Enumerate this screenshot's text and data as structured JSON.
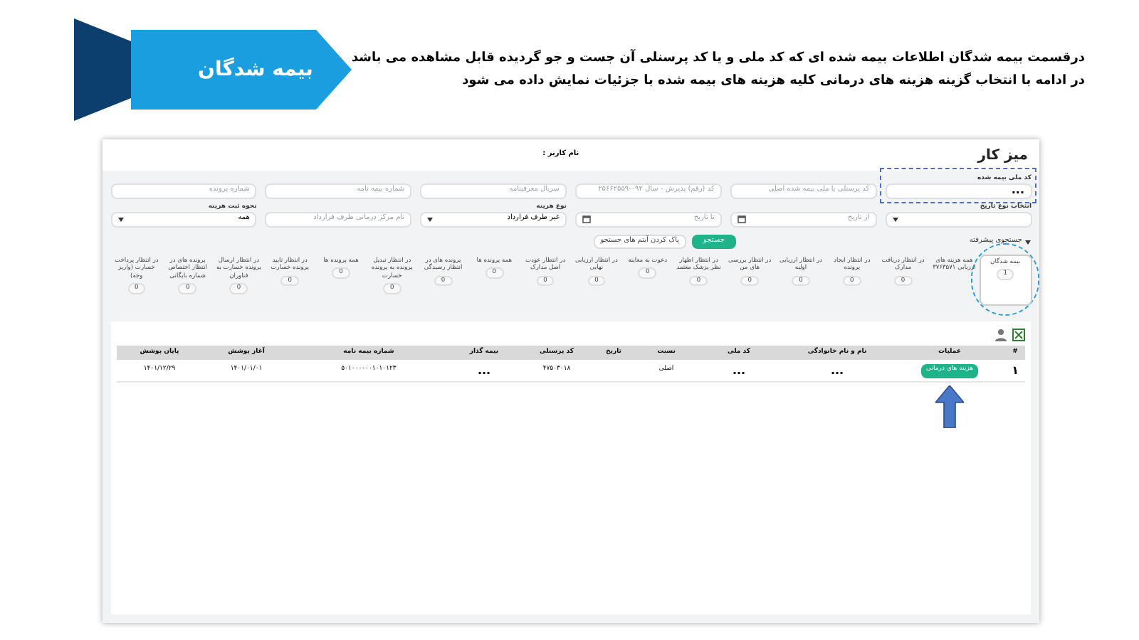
{
  "banner": {
    "title": "بیمه شدگان"
  },
  "description": [
    "درقسمت بیمه شدگان اطلاعات بیمه شده ای که کد ملی و یا کد پرسنلی آن جست و جو گردیده قابل مشاهده می باشد",
    "در ادامه با انتخاب گزینه هزینه های درمانی کلیه هزینه های بیمه شده با جزئیات نمایش داده می شود"
  ],
  "screen": {
    "title": "میز کار",
    "user_label": "نام کاربر :",
    "filters": [
      {
        "kind": "dots",
        "label": "کد ملی بیمه شده",
        "value": "...",
        "highlighted": true
      },
      {
        "kind": "text",
        "placeholder": "کد پرسنلی یا ملی بیمه شده اصلی",
        "highlighted": false
      },
      {
        "kind": "text",
        "placeholder": "کد (رقم) پذیرش - سال  ۰۹۲-۲۵۶۶۲۵۵۹",
        "highlighted": false
      },
      {
        "kind": "text",
        "placeholder": "سریال معرفینامه",
        "highlighted": false
      },
      {
        "kind": "text",
        "placeholder": "شماره بیمه نامه",
        "highlighted": false
      },
      {
        "kind": "text",
        "placeholder": "شماره پرونده",
        "highlighted": false
      },
      {
        "kind": "select",
        "label": "انتخاب نوع تاریخ",
        "highlighted": false
      },
      {
        "kind": "date",
        "placeholder": "از تاریخ",
        "highlighted": false
      },
      {
        "kind": "date",
        "placeholder": "تا تاریخ",
        "highlighted": false
      },
      {
        "kind": "select",
        "label": "نوع هزینه",
        "value": "غیر طرف قرارداد",
        "highlighted": false
      },
      {
        "kind": "text",
        "placeholder": "نام مرکز درمانی طرف قرارداد",
        "highlighted": false
      },
      {
        "kind": "select",
        "label": "نحوه ثبت هزینه",
        "value": "همه",
        "highlighted": false
      }
    ],
    "advanced_search": "جستجوی پیشرفته",
    "buttons": [
      {
        "label": "جستجو",
        "kind": "primary"
      },
      {
        "label": "پاک کردن آیتم های جستجو",
        "kind": "secondary"
      }
    ],
    "status_tabs": [
      {
        "label": "بیمه شدگان",
        "count": "1",
        "selected": true,
        "highlighted": true
      },
      {
        "label": "همه هزینه های ارزیابی ۳۷۶۳۵۷۱",
        "selected": false,
        "highlighted": false
      },
      {
        "label": "در انتظار دریافت مدارک",
        "count": "0",
        "selected": false,
        "highlighted": false
      },
      {
        "label": "در انتظار ایجاد پرونده",
        "count": "0",
        "selected": false,
        "highlighted": false
      },
      {
        "label": "در انتظار ارزیابی اولیه",
        "count": "0",
        "selected": false,
        "highlighted": false
      },
      {
        "label": "در انتظار بررسی های من",
        "count": "0",
        "selected": false,
        "highlighted": false
      },
      {
        "label": "در انتظار اظهار نظر پزشک معتمد",
        "count": "0",
        "selected": false,
        "highlighted": false
      },
      {
        "label": "دعوت به معاینه",
        "count": "0",
        "selected": false,
        "highlighted": false
      },
      {
        "label": "در انتظار ارزیابی نهایی",
        "count": "0",
        "selected": false,
        "highlighted": false
      },
      {
        "label": "در انتظار عودت اصل مدارک",
        "count": "0",
        "selected": false,
        "highlighted": false
      },
      {
        "label": "همه پرونده ها",
        "count": "0",
        "selected": false,
        "highlighted": false
      },
      {
        "label": "پرونده های در انتظار رسیدگی",
        "count": "0",
        "selected": false,
        "highlighted": false
      },
      {
        "label": "در انتظار تبدیل پرونده به پرونده خسارت",
        "count": "0",
        "selected": false,
        "highlighted": false
      },
      {
        "label": "همه پرونده ها",
        "count": "0",
        "selected": false,
        "highlighted": false
      },
      {
        "label": "در انتظار تایید پرونده خسارت",
        "count": "0",
        "selected": false,
        "highlighted": false
      },
      {
        "label": "در انتظار ارسال پرونده خسارت به فناوران",
        "count": "0",
        "selected": false,
        "highlighted": false
      },
      {
        "label": "پرونده های در انتظار اختصاص شماره بایگانی",
        "count": "0",
        "selected": false,
        "highlighted": false
      },
      {
        "label": "در انتظار پرداخت خسارت (واریز وجه)",
        "count": "0",
        "selected": false,
        "highlighted": false
      }
    ],
    "table": {
      "columns": [
        "#",
        "عملیات",
        "نام و نام خانوادگی",
        "کد ملی",
        "نسبت",
        "تاریخ",
        "کد پرسنلی",
        "بیمه گذار",
        "شماره بیمه نامه",
        "آغاز پوشش",
        "پایان پوشش"
      ],
      "rows": [
        [
          {
            "kind": "text",
            "text": "۱"
          },
          {
            "kind": "button",
            "text": "هزینه های درمانی",
            "highlighted": true
          },
          {
            "kind": "text",
            "text": "..."
          },
          {
            "kind": "text",
            "text": "..."
          },
          {
            "kind": "text",
            "text": "اصلی"
          },
          {
            "kind": "empty"
          },
          {
            "kind": "text",
            "text": "۴۷۵۰۳۰۱۸"
          },
          {
            "kind": "text",
            "text": "..."
          },
          {
            "kind": "text",
            "text": "۵۰۱۰۰۰۰۰۰۱۰۱۰۱۲۳"
          },
          {
            "kind": "text",
            "text": "۱۴۰۱/۰۱/۰۱"
          },
          {
            "kind": "text",
            "text": "۱۴۰۱/۱۲/۲۹"
          }
        ]
      ]
    }
  }
}
